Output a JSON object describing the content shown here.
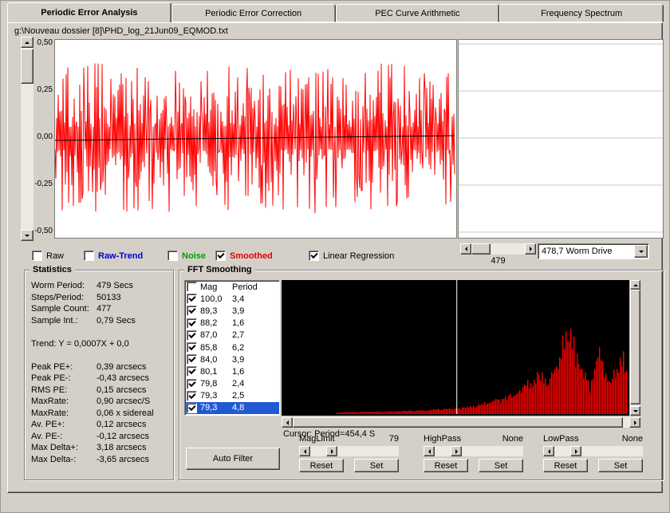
{
  "tabs": [
    {
      "label": "Periodic Error Analysis",
      "active": true
    },
    {
      "label": "Periodic Error Correction",
      "active": false
    },
    {
      "label": "PEC Curve Arithmetic",
      "active": false
    },
    {
      "label": "Frequency Spectrum",
      "active": false
    }
  ],
  "file_path": "g:\\Nouveau dossier [8]\\PHD_log_21Jun09_EQMOD.txt",
  "main_chart": {
    "y_ticks": [
      "0,50",
      "0,25",
      "0,00",
      "-0,25",
      "-0,50"
    ],
    "series_color": "#ff0000",
    "regression_color": "#000000",
    "noise": {
      "points": 501,
      "seed": 7,
      "base_amp": 0.06,
      "spike_amp": 0.34
    }
  },
  "scroll_value": "479",
  "worm_select": "478,7 Worm Drive",
  "display_options": [
    {
      "label": "Raw",
      "checked": false,
      "color": "#000000",
      "bold": false
    },
    {
      "label": "Raw-Trend",
      "checked": false,
      "color": "#0000d0",
      "bold": true
    },
    {
      "label": "Noise",
      "checked": false,
      "color": "#00a000",
      "bold": true
    },
    {
      "label": "Smoothed",
      "checked": true,
      "color": "#e00000",
      "bold": true
    },
    {
      "label": "Linear Regression",
      "checked": true,
      "color": "#000000",
      "bold": false
    }
  ],
  "statistics": {
    "title": "Statistics",
    "rows": [
      {
        "label": "Worm Period:",
        "value": "479 Secs"
      },
      {
        "label": "Steps/Period:",
        "value": "50133"
      },
      {
        "label": "Sample Count:",
        "value": "477"
      },
      {
        "label": "Sample Int.:",
        "value": "0,79 Secs"
      },
      {
        "label": "",
        "value": ""
      },
      {
        "label": "Trend: Y = 0,0007X + 0,0",
        "value": ""
      },
      {
        "label": "",
        "value": ""
      },
      {
        "label": "Peak PE+:",
        "value": "0,39 arcsecs"
      },
      {
        "label": "Peak PE-:",
        "value": "-0,43 arcsecs"
      },
      {
        "label": "RMS PE:",
        "value": "0,15 arcsecs"
      },
      {
        "label": "MaxRate:",
        "value": "0,90 arcsec/S"
      },
      {
        "label": "MaxRate:",
        "value": "0,06 x sidereal"
      },
      {
        "label": "Av. PE+:",
        "value": "0,12 arcsecs"
      },
      {
        "label": "Av. PE-:",
        "value": "-0,12 arcsecs"
      },
      {
        "label": "Max Delta+:",
        "value": "3,18 arcsecs"
      },
      {
        "label": "Max Delta-:",
        "value": "-3,65 arcsecs"
      }
    ]
  },
  "fft": {
    "title": "FFT Smoothing",
    "header": {
      "checked": false,
      "mag": "Mag",
      "period": "Period"
    },
    "harmonics": [
      {
        "mag": "100,0",
        "period": "3,4",
        "checked": true,
        "selected": false
      },
      {
        "mag": "89,3",
        "period": "3,9",
        "checked": true,
        "selected": false
      },
      {
        "mag": "88,2",
        "period": "1,6",
        "checked": true,
        "selected": false
      },
      {
        "mag": "87,0",
        "period": "2,7",
        "checked": true,
        "selected": false
      },
      {
        "mag": "85,8",
        "period": "6,2",
        "checked": true,
        "selected": false
      },
      {
        "mag": "84,0",
        "period": "3,9",
        "checked": true,
        "selected": false
      },
      {
        "mag": "80,1",
        "period": "1,6",
        "checked": true,
        "selected": false
      },
      {
        "mag": "79,8",
        "period": "2,4",
        "checked": true,
        "selected": false
      },
      {
        "mag": "79,3",
        "period": "2,5",
        "checked": true,
        "selected": false
      },
      {
        "mag": "79,3",
        "period": "4,8",
        "checked": true,
        "selected": true
      }
    ],
    "selection_color": "#2159d3",
    "cursor_text": "Cursor: Period=454,4 S",
    "auto_filter_label": "Auto Filter",
    "spectrum": {
      "bar_color": "#ff0000",
      "cursor_color": "#ffffff",
      "cursor_pos": 0.505,
      "envelope": [
        [
          0,
          0
        ],
        [
          0.14,
          0
        ],
        [
          0.17,
          0.015
        ],
        [
          0.3,
          0.02
        ],
        [
          0.42,
          0.03
        ],
        [
          0.5,
          0.045
        ],
        [
          0.55,
          0.06
        ],
        [
          0.6,
          0.09
        ],
        [
          0.65,
          0.13
        ],
        [
          0.7,
          0.2
        ],
        [
          0.74,
          0.32
        ],
        [
          0.77,
          0.25
        ],
        [
          0.8,
          0.48
        ],
        [
          0.83,
          0.62
        ],
        [
          0.86,
          0.4
        ],
        [
          0.89,
          0.22
        ],
        [
          0.915,
          0.48
        ],
        [
          0.94,
          0.26
        ],
        [
          0.965,
          0.32
        ],
        [
          0.985,
          0.42
        ],
        [
          1,
          0.38
        ]
      ]
    },
    "filters": [
      {
        "name": "MagLimit",
        "value": "79"
      },
      {
        "name": "HighPass",
        "value": "None"
      },
      {
        "name": "LowPass",
        "value": "None"
      }
    ],
    "reset_label": "Reset",
    "set_label": "Set"
  }
}
